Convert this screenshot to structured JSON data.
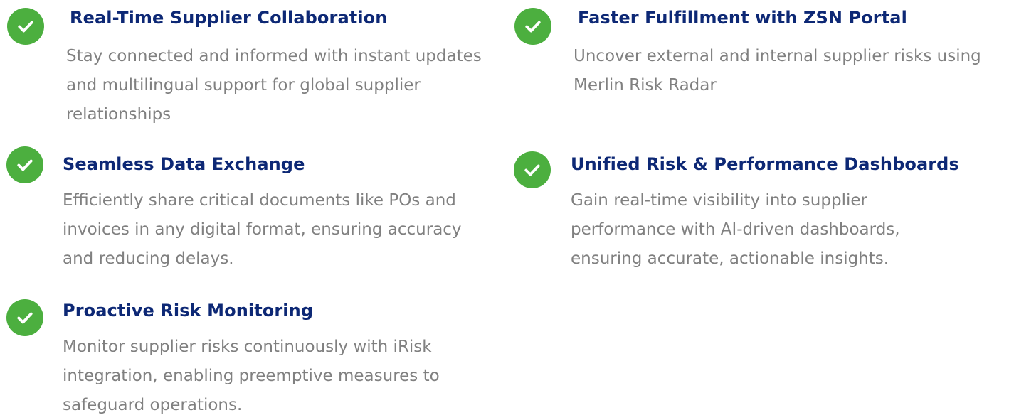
{
  "features": [
    {
      "title": "Real-Time Supplier Collaboration",
      "description": "Stay connected and informed with instant updates and multilingual support for global supplier relationships",
      "icon": "check-circle-icon"
    },
    {
      "title": "Faster Fulfillment with ZSN Portal",
      "description": "Uncover external and internal supplier risks using Merlin Risk Radar",
      "icon": "check-circle-icon"
    },
    {
      "title": "Seamless Data Exchange",
      "description": "Efficiently share critical documents like POs and invoices in any digital format, ensuring accuracy and reducing delays.",
      "icon": "check-circle-icon"
    },
    {
      "title": "Unified Risk & Performance Dashboards",
      "description": "Gain real-time visibility into supplier performance with AI-driven dashboards, ensuring accurate, actionable insights.",
      "icon": "check-circle-icon"
    },
    {
      "title": "Proactive Risk Monitoring",
      "description": "Monitor supplier risks continuously with iRisk integration, enabling preemptive measures to safeguard operations.",
      "icon": "check-circle-icon"
    }
  ],
  "colors": {
    "check_green": "#4caf3f",
    "title_navy": "#0d2875",
    "body_gray": "#808080"
  }
}
